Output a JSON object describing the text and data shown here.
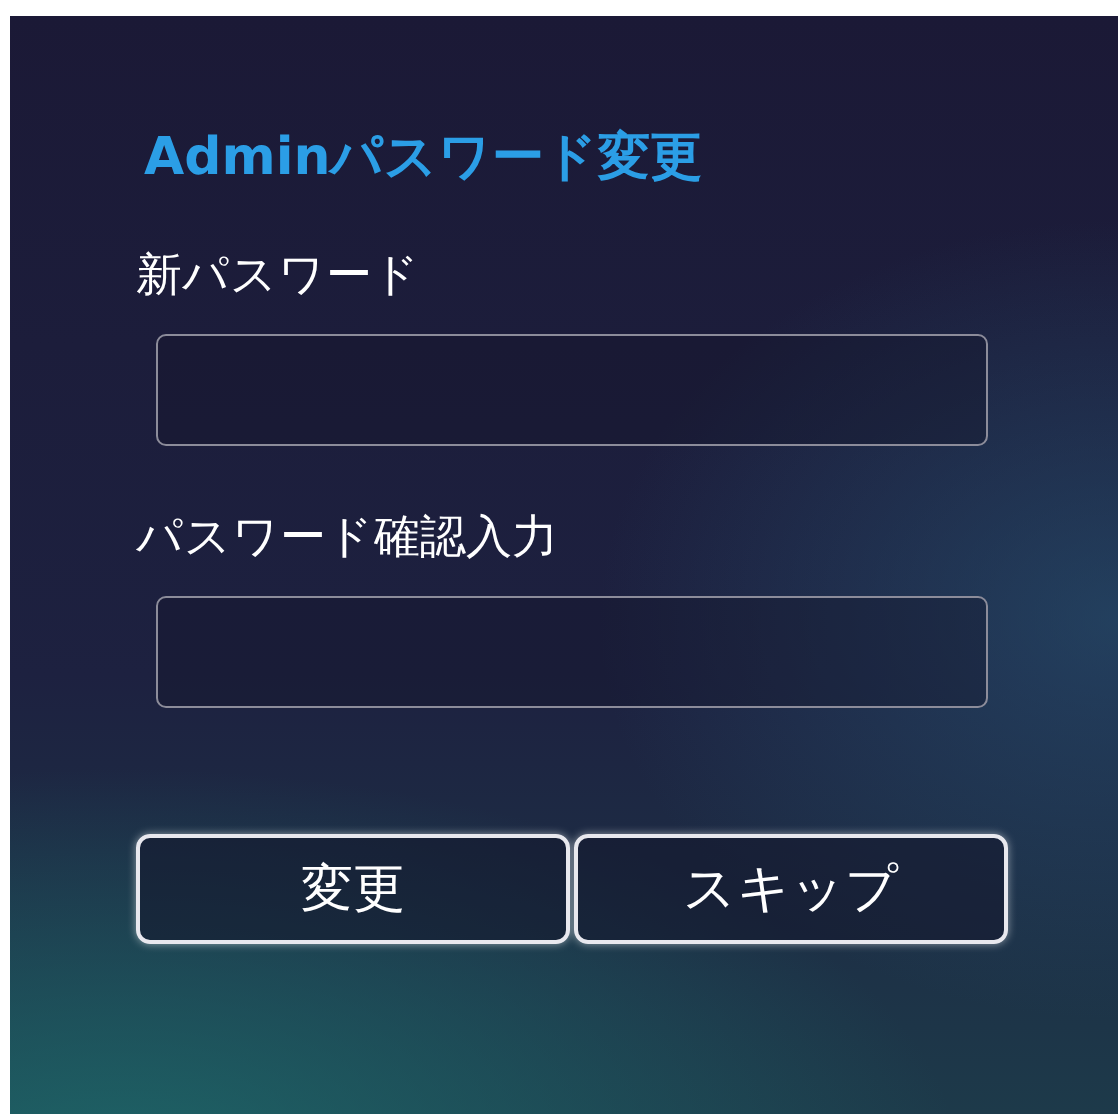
{
  "title": "Adminパスワード変更",
  "fields": [
    {
      "label": "新パスワード"
    },
    {
      "label": "パスワード確認入力"
    }
  ],
  "buttons": [
    {
      "label": "変更"
    },
    {
      "label": "スキップ"
    }
  ]
}
